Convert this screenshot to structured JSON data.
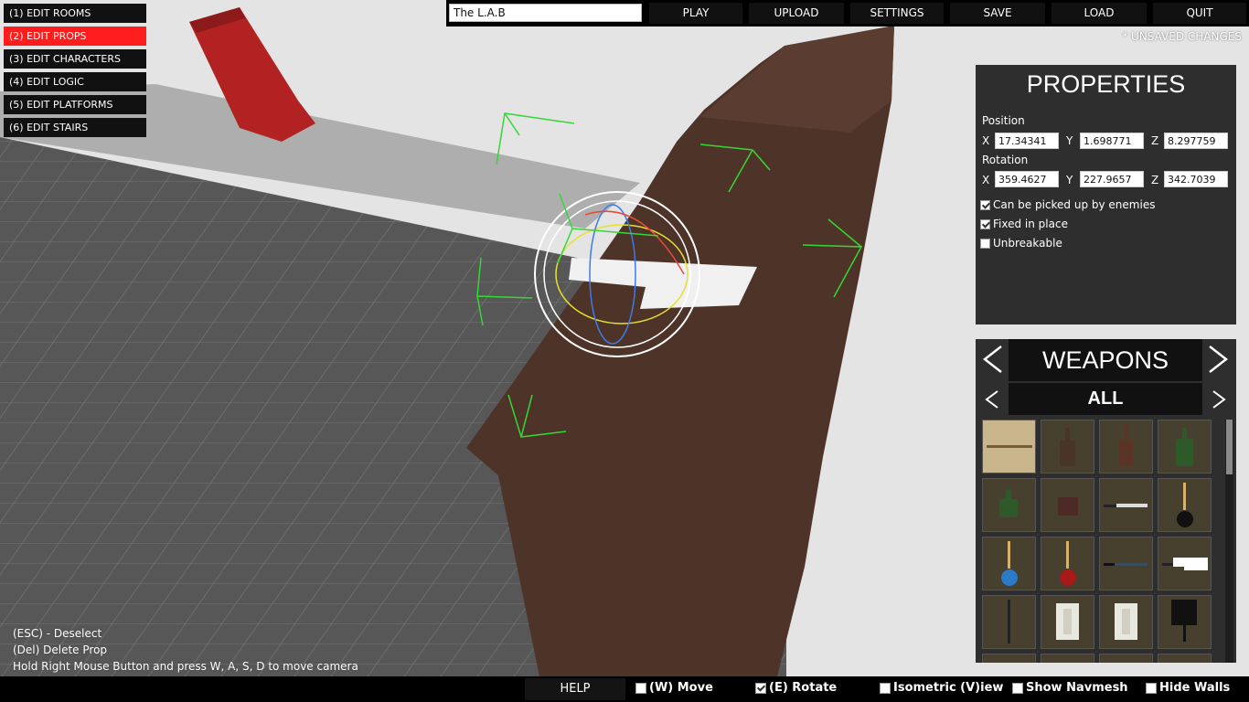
{
  "mode_menu": [
    {
      "label": "(1) EDIT ROOMS",
      "active": false
    },
    {
      "label": "(2) EDIT PROPS",
      "active": true
    },
    {
      "label": "(3) EDIT CHARACTERS",
      "active": false
    },
    {
      "label": "(4) EDIT LOGIC",
      "active": false
    },
    {
      "label": "(5) EDIT PLATFORMS",
      "active": false
    },
    {
      "label": "(6) EDIT STAIRS",
      "active": false
    }
  ],
  "topbar": {
    "level_name": "The L.A.B",
    "buttons": [
      "PLAY",
      "UPLOAD",
      "SETTINGS",
      "SAVE",
      "LOAD",
      "QUIT"
    ],
    "unsaved": "* UNSAVED CHANGES"
  },
  "properties": {
    "title": "PROPERTIES",
    "position_label": "Position",
    "rotation_label": "Rotation",
    "axis_x": "X",
    "axis_y": "Y",
    "axis_z": "Z",
    "position": {
      "x": "17.34341",
      "y": "1.698771",
      "z": "8.297759"
    },
    "rotation": {
      "x": "359.4627",
      "y": "227.9657",
      "z": "342.7039"
    },
    "options": [
      {
        "label": "Can be picked up by enemies",
        "checked": true
      },
      {
        "label": "Fixed in place",
        "checked": true
      },
      {
        "label": "Unbreakable",
        "checked": false
      }
    ]
  },
  "weapons": {
    "category": "WEAPONS",
    "subcategory": "ALL",
    "prev_icon": "chevron-left-icon",
    "next_icon": "chevron-right-icon"
  },
  "hints": [
    "(ESC) - Deselect",
    "(Del) Delete Prop",
    "Hold Right Mouse Button and press W, A, S, D to move camera"
  ],
  "bottombar": {
    "help": "HELP",
    "options": [
      {
        "label": "(W) Move",
        "checked": false
      },
      {
        "label": "(E) Rotate",
        "checked": true
      },
      {
        "label": "Isometric (V)iew",
        "checked": false
      },
      {
        "label": "Show Navmesh",
        "checked": false
      },
      {
        "label": "Hide Walls",
        "checked": false
      }
    ]
  }
}
